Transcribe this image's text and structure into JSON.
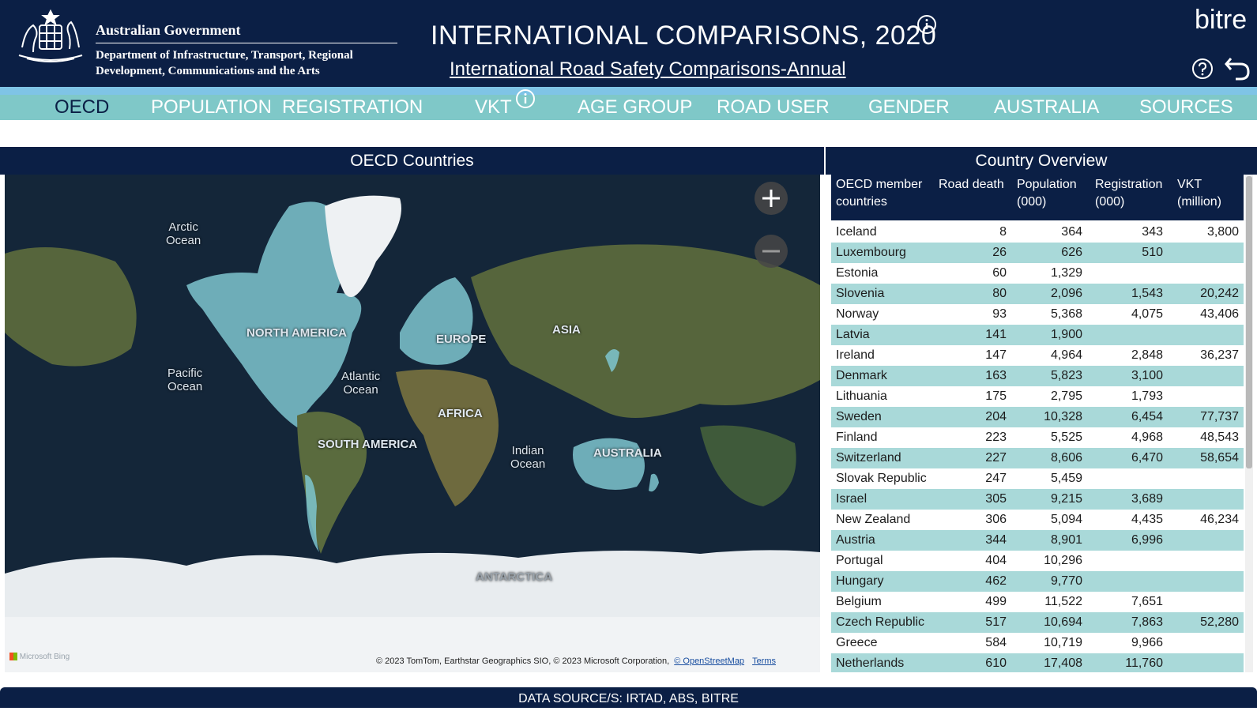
{
  "header": {
    "gov_title": "Australian Government",
    "gov_dept": "Department of Infrastructure, Transport, Regional Development, Communications and the Arts",
    "main_title": "INTERNATIONAL COMPARISONS, 2020",
    "sub_title": "International Road Safety Comparisons-Annual",
    "brand": "bitre"
  },
  "nav": {
    "items": [
      {
        "label": "OECD"
      },
      {
        "label": "POPULATION"
      },
      {
        "label": "REGISTRATION"
      },
      {
        "label": "VKT"
      },
      {
        "label": "AGE GROUP"
      },
      {
        "label": "ROAD USER"
      },
      {
        "label": "GENDER"
      },
      {
        "label": "AUSTRALIA"
      },
      {
        "label": "SOURCES"
      }
    ]
  },
  "map": {
    "title": "OECD Countries",
    "labels": {
      "arctic": "Arctic\nOcean",
      "north_america": "NORTH AMERICA",
      "europe": "EUROPE",
      "asia": "ASIA",
      "pacific": "Pacific\nOcean",
      "atlantic": "Atlantic\nOcean",
      "africa": "AFRICA",
      "south_america": "SOUTH AMERICA",
      "indian": "Indian\nOcean",
      "australia": "AUSTRALIA",
      "antarctica": "ANTARCTICA"
    },
    "attribution": "© 2023 TomTom, Earthstar Geographics SIO, © 2023 Microsoft Corporation,",
    "osm_link": "© OpenStreetMap",
    "terms_link": "Terms",
    "bing": "Microsoft Bing"
  },
  "overview": {
    "title": "Country Overview",
    "columns": [
      "OECD member countries",
      "Road death",
      "Population (000)",
      "Registration (000)",
      "VKT (million)"
    ],
    "rows": [
      [
        "Iceland",
        "8",
        "364",
        "343",
        "3,800"
      ],
      [
        "Luxembourg",
        "26",
        "626",
        "510",
        ""
      ],
      [
        "Estonia",
        "60",
        "1,329",
        "",
        ""
      ],
      [
        "Slovenia",
        "80",
        "2,096",
        "1,543",
        "20,242"
      ],
      [
        "Norway",
        "93",
        "5,368",
        "4,075",
        "43,406"
      ],
      [
        "Latvia",
        "141",
        "1,900",
        "",
        ""
      ],
      [
        "Ireland",
        "147",
        "4,964",
        "2,848",
        "36,237"
      ],
      [
        "Denmark",
        "163",
        "5,823",
        "3,100",
        ""
      ],
      [
        "Lithuania",
        "175",
        "2,795",
        "1,793",
        ""
      ],
      [
        "Sweden",
        "204",
        "10,328",
        "6,454",
        "77,737"
      ],
      [
        "Finland",
        "223",
        "5,525",
        "4,968",
        "48,543"
      ],
      [
        "Switzerland",
        "227",
        "8,606",
        "6,470",
        "58,654"
      ],
      [
        "Slovak Republic",
        "247",
        "5,459",
        "",
        ""
      ],
      [
        "Israel",
        "305",
        "9,215",
        "3,689",
        ""
      ],
      [
        "New Zealand",
        "306",
        "5,094",
        "4,435",
        "46,234"
      ],
      [
        "Austria",
        "344",
        "8,901",
        "6,996",
        ""
      ],
      [
        "Portugal",
        "404",
        "10,296",
        "",
        ""
      ],
      [
        "Hungary",
        "462",
        "9,770",
        "",
        ""
      ],
      [
        "Belgium",
        "499",
        "11,522",
        "7,651",
        ""
      ],
      [
        "Czech Republic",
        "517",
        "10,694",
        "7,863",
        "52,280"
      ],
      [
        "Greece",
        "584",
        "10,719",
        "9,966",
        ""
      ],
      [
        "Netherlands",
        "610",
        "17,408",
        "11,760",
        ""
      ]
    ]
  },
  "footer": {
    "source": "DATA SOURCE/S: IRTAD, ABS, BITRE"
  },
  "colors": {
    "navy": "#0b1f45",
    "teal_nav": "#7fc8c8",
    "row_alt": "#a9d9d9",
    "oecd_highlight": "#7ec6cf"
  }
}
